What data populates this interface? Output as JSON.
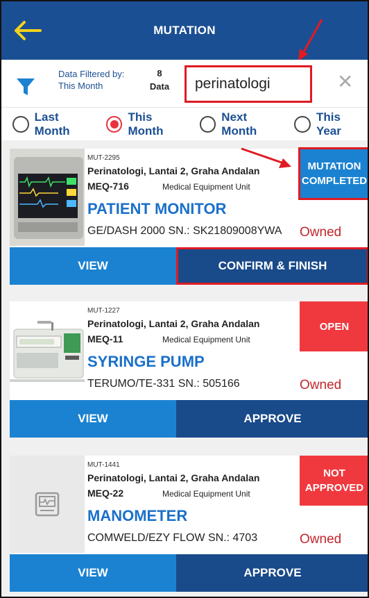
{
  "header": {
    "title": "MUTATION"
  },
  "filter": {
    "label_line1": "Data Filtered by:",
    "label_line2": "This Month",
    "count_value": "8",
    "count_label": "Data",
    "search_value": "perinatologi"
  },
  "periods": [
    {
      "label": "Last Month",
      "selected": false
    },
    {
      "label": "This Month",
      "selected": true
    },
    {
      "label": "Next Month",
      "selected": false
    },
    {
      "label": "This Year",
      "selected": false
    }
  ],
  "cards": [
    {
      "code": "MUT-2295",
      "location": "Perinatologi, Lantai 2, Graha Andalan",
      "meq": "MEQ-716",
      "unit": "Medical Equipment Unit",
      "name": "PATIENT MONITOR",
      "model": "GE/DASH 2000  SN.: SK21809008YWA",
      "ownership": "Owned",
      "status_line1": "MUTATION",
      "status_line2": "COMPLETED",
      "view_label": "VIEW",
      "action_label": "CONFIRM & FINISH"
    },
    {
      "code": "MUT-1227",
      "location": "Perinatologi, Lantai 2, Graha Andalan",
      "meq": "MEQ-11",
      "unit": "Medical Equipment Unit",
      "name": "SYRINGE PUMP",
      "model": "TERUMO/TE-331  SN.: 505166",
      "ownership": "Owned",
      "status_line1": "OPEN",
      "status_line2": "",
      "view_label": "VIEW",
      "action_label": "APPROVE"
    },
    {
      "code": "MUT-1441",
      "location": "Perinatologi, Lantai 2, Graha Andalan",
      "meq": "MEQ-22",
      "unit": "Medical Equipment Unit",
      "name": "MANOMETER",
      "model": "COMWELD/EZY FLOW  SN.: 4703",
      "ownership": "Owned",
      "status_line1": "NOT",
      "status_line2": "APPROVED",
      "view_label": "VIEW",
      "action_label": "APPROVE"
    }
  ],
  "colors": {
    "header_bg": "#1b4f93",
    "accent_blue": "#1b82d1",
    "dark_blue": "#194a8a",
    "status_red": "#f0393f",
    "annotation_red": "#e01b22",
    "back_arrow": "#f2d31b"
  },
  "icons": {
    "back": "arrow-left-icon",
    "filter": "funnel-icon",
    "clear": "close-icon",
    "placeholder": "device-placeholder-icon"
  }
}
